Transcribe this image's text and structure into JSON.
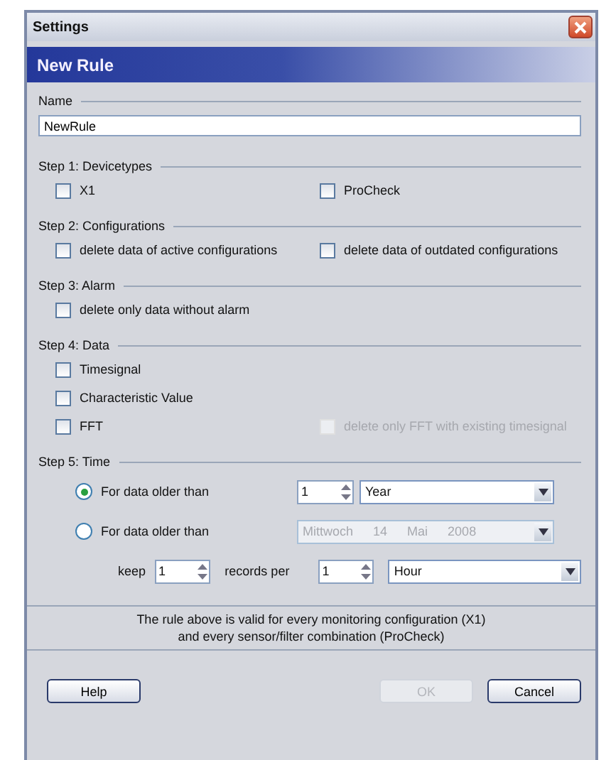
{
  "window": {
    "title": "Settings"
  },
  "header": "New Rule",
  "name": {
    "label": "Name",
    "value": "NewRule"
  },
  "steps": [
    {
      "title": "Step 1: Devicetypes",
      "rows": [
        [
          {
            "label": "X1",
            "checked": false,
            "disabled": false
          },
          {
            "label": "ProCheck",
            "checked": false,
            "disabled": false
          }
        ]
      ]
    },
    {
      "title": "Step 2: Configurations",
      "rows": [
        [
          {
            "label": "delete data of active configurations",
            "checked": false,
            "disabled": false
          },
          {
            "label": "delete data of outdated configurations",
            "checked": false,
            "disabled": false
          }
        ]
      ]
    },
    {
      "title": "Step 3: Alarm",
      "rows": [
        [
          {
            "label": "delete only data without alarm",
            "checked": false,
            "disabled": false
          }
        ]
      ]
    },
    {
      "title": "Step 4: Data",
      "rows": [
        [
          {
            "label": "Timesignal",
            "checked": false,
            "disabled": false
          }
        ],
        [
          {
            "label": "Characteristic Value",
            "checked": false,
            "disabled": false
          }
        ],
        [
          {
            "label": "FFT",
            "checked": false,
            "disabled": false
          },
          {
            "label": "delete only FFT with existing timesignal",
            "checked": false,
            "disabled": true
          }
        ]
      ]
    }
  ],
  "time": {
    "title": "Step 5: Time",
    "options": [
      {
        "kind": "amount",
        "label": "For data older than",
        "selected": true,
        "amount": "1",
        "unit": "Year",
        "disabled": false
      },
      {
        "kind": "date",
        "label": "For data older than",
        "selected": false,
        "date": [
          "Mittwoch",
          "14",
          "Mai",
          "2008"
        ],
        "disabled": true
      }
    ],
    "keep": {
      "label": "keep",
      "count": "1",
      "per_label": "records per",
      "amount": "1",
      "unit": "Hour"
    }
  },
  "note": [
    "The rule above is valid for every monitoring configuration (X1)",
    "and every sensor/filter combination (ProCheck)"
  ],
  "buttons": [
    {
      "label": "Help",
      "disabled": false
    },
    {
      "label": "OK",
      "disabled": true
    },
    {
      "label": "Cancel",
      "disabled": false
    }
  ]
}
